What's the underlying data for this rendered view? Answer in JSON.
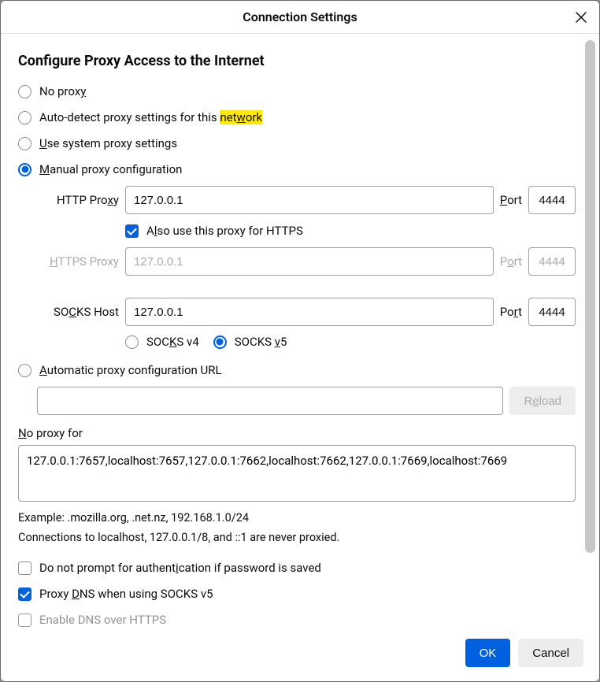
{
  "dialog": {
    "title": "Connection Settings"
  },
  "heading": "Configure Proxy Access to the Internet",
  "radios": {
    "no_proxy_before": "No prox",
    "no_proxy_u": "y",
    "auto_detect_before": "Auto-detect proxy settings for this ",
    "auto_detect_hl_before": "net",
    "auto_detect_hl_u": "w",
    "auto_detect_hl_after": "ork",
    "system_u": "U",
    "system_after": "se system proxy settings",
    "manual_u": "M",
    "manual_after": "anual proxy configuration",
    "auto_url_u": "A",
    "auto_url_after": "utomatic proxy configuration URL"
  },
  "http": {
    "label_before": "HTTP Pro",
    "label_u": "x",
    "label_after": "y",
    "value": "127.0.0.1",
    "port_label_u": "P",
    "port_label_after": "ort",
    "port": "4444"
  },
  "also_https": {
    "before": "A",
    "u": "l",
    "after": "so use this proxy for HTTPS"
  },
  "https": {
    "label_u": "H",
    "label_after": "TTPS Proxy",
    "value": "127.0.0.1",
    "port_label_before": "P",
    "port_label_u": "o",
    "port_label_after": "rt",
    "port": "4444"
  },
  "socks": {
    "label_before": "SO",
    "label_u": "C",
    "label_after": "KS Host",
    "value": "127.0.0.1",
    "port_label_before": "Po",
    "port_label_u": "r",
    "port_label_after": "t",
    "port": "4444",
    "v4_before": "SOC",
    "v4_u": "K",
    "v4_after": "S v4",
    "v5_before": "SOCKS ",
    "v5_u": "v",
    "v5_after": "5"
  },
  "reload": {
    "before": "R",
    "u": "e",
    "after": "load"
  },
  "no_proxy_for": {
    "label_u": "N",
    "label_after": "o proxy for",
    "value": "127.0.0.1:7657,localhost:7657,127.0.0.1:7662,localhost:7662,127.0.0.1:7669,localhost:7669"
  },
  "example": "Example: .mozilla.org, .net.nz, 192.168.1.0/24",
  "localhost_note": "Connections to localhost, 127.0.0.1/8, and ::1 are never proxied.",
  "check_no_prompt": {
    "before": "Do not prompt for authent",
    "u": "i",
    "after": "cation if password is saved"
  },
  "check_proxy_dns": {
    "before": "Proxy ",
    "u": "D",
    "after": "NS when using SOCKS v5"
  },
  "check_dns_https": "Enable DNS over HTTPS",
  "buttons": {
    "ok": "OK",
    "cancel": "Cancel"
  }
}
